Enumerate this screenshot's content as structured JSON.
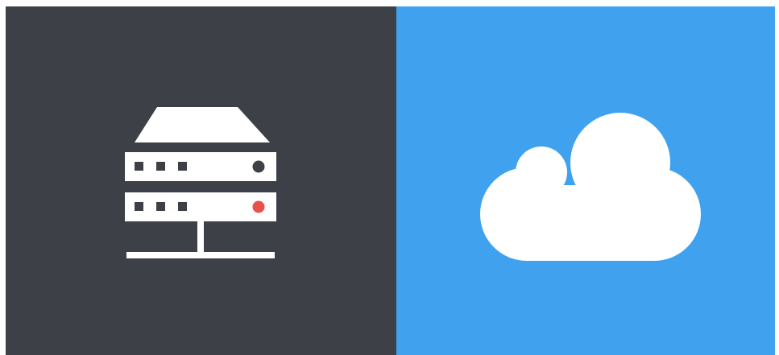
{
  "colors": {
    "page_background": "#ffffff",
    "left_panel": "#3d4046",
    "right_panel": "#40a2ef",
    "icon_fill": "#ffffff",
    "status_led_dark": "#3d4046",
    "status_led_alert": "#e9504a"
  },
  "left_panel": {
    "icon": "server-rack-icon"
  },
  "right_panel": {
    "icon": "cloud-icon"
  }
}
